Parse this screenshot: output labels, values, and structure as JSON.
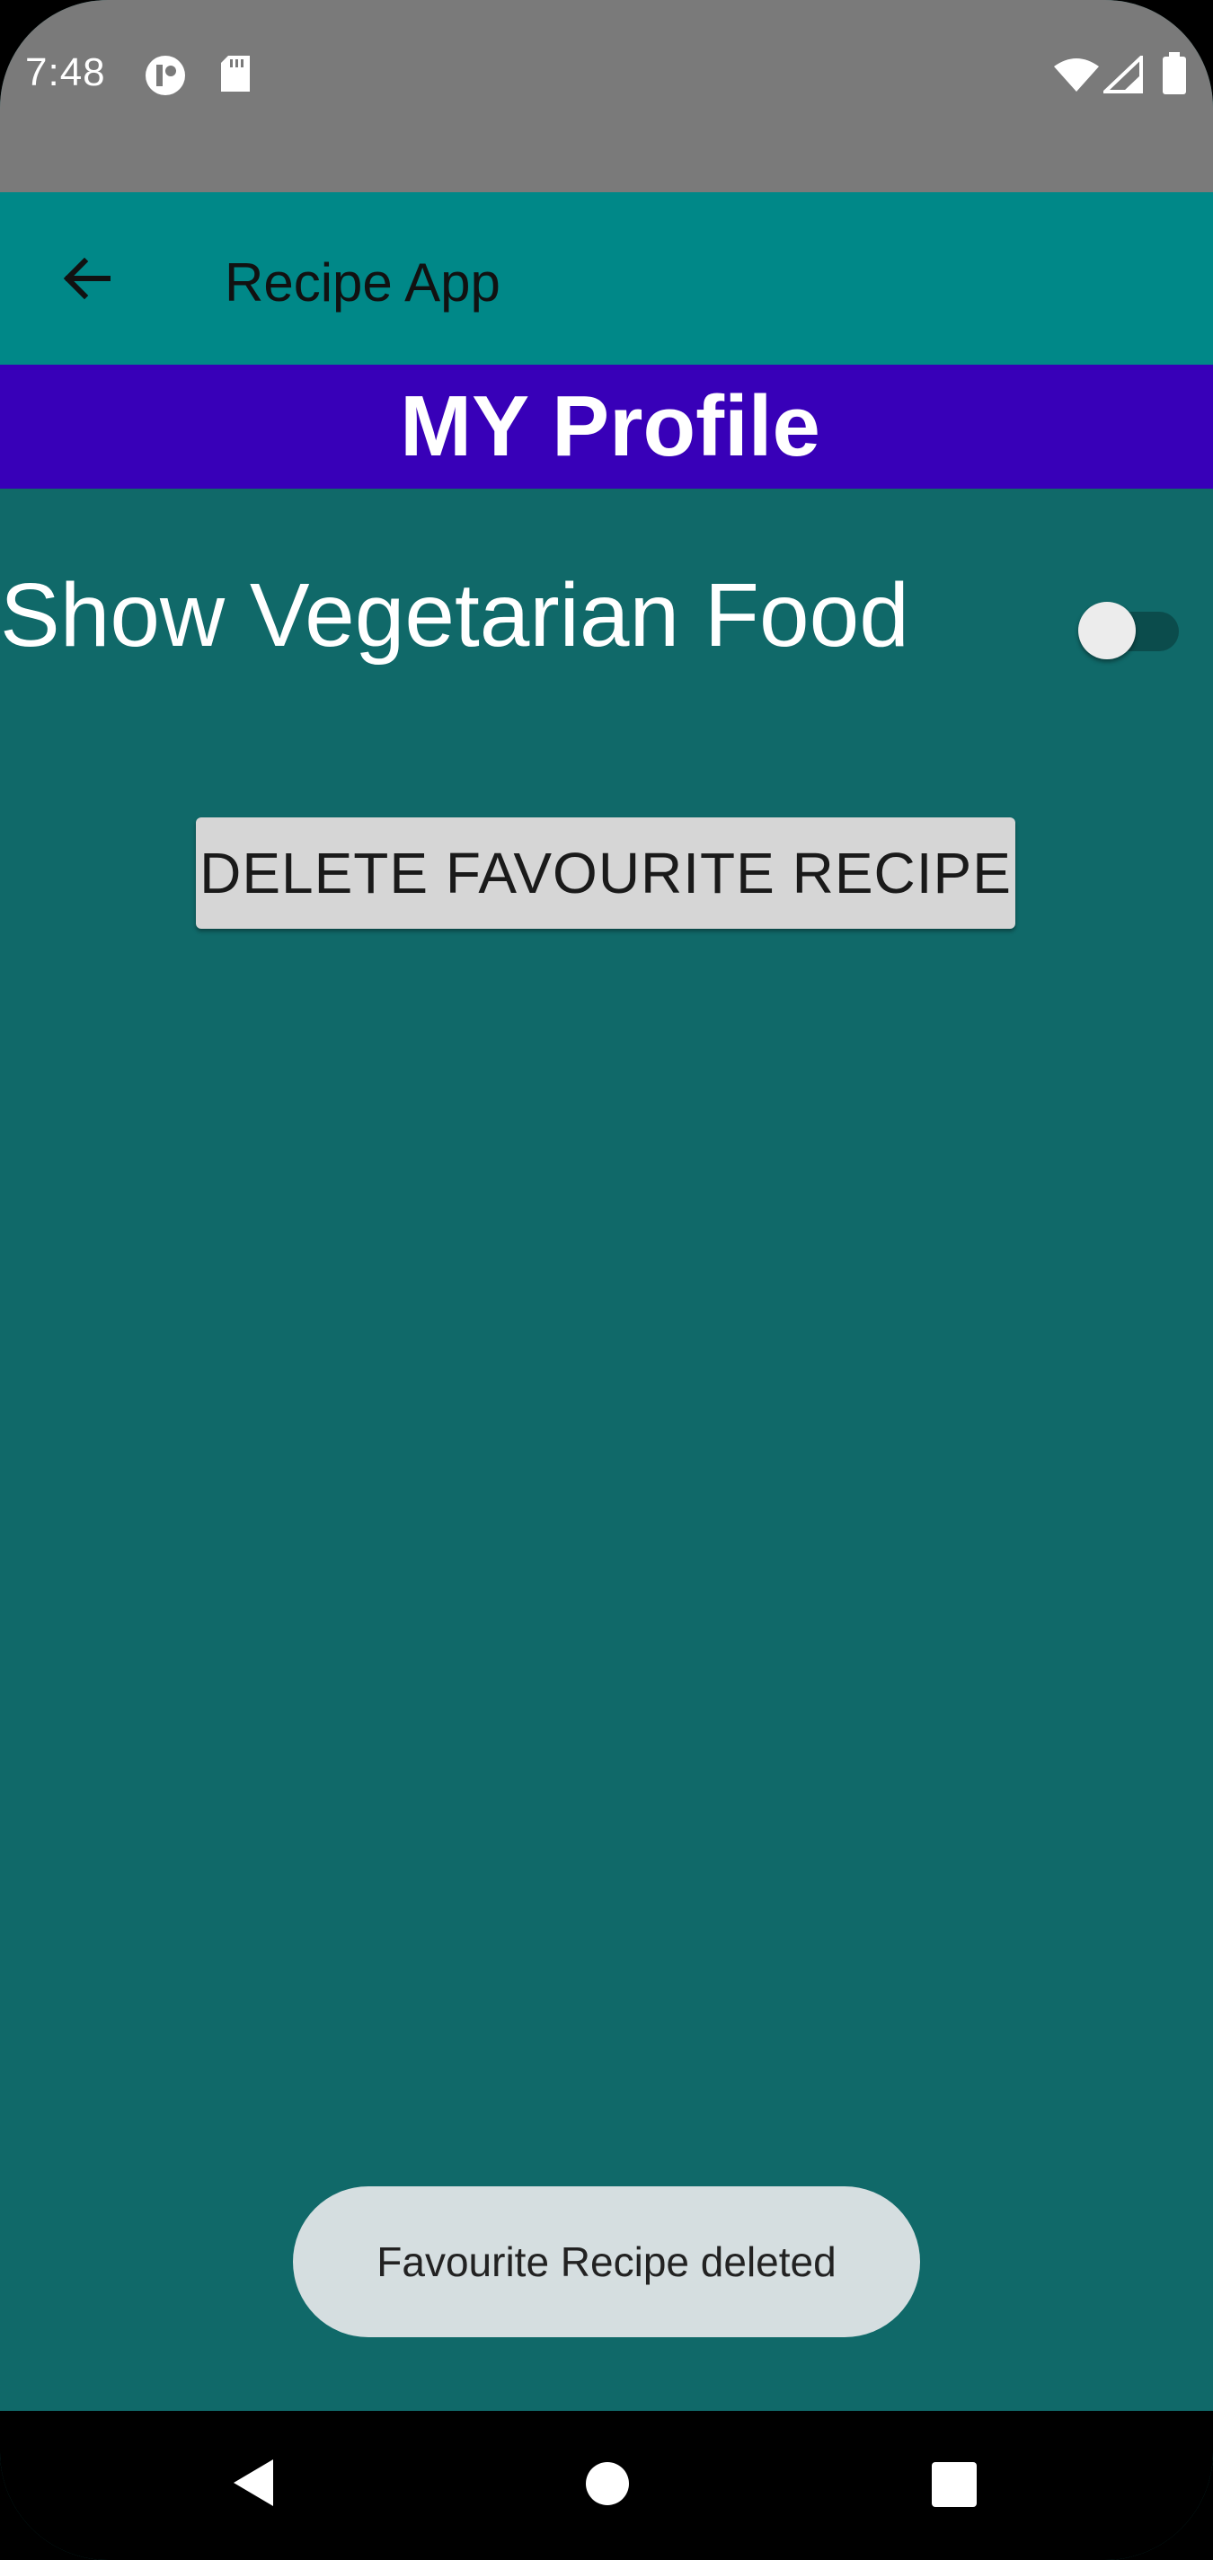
{
  "status_bar": {
    "time": "7:48",
    "left_icons": [
      "app-notification-icon",
      "sd-card-icon"
    ],
    "right_icons": [
      "wifi-icon",
      "signal-icon",
      "battery-icon"
    ]
  },
  "app_bar": {
    "title": "Recipe App",
    "back_icon": "arrow-back-icon"
  },
  "profile_banner": {
    "title": "MY Profile"
  },
  "settings": {
    "vegetarian_label": "Show Vegetarian Food",
    "vegetarian_enabled": false
  },
  "actions": {
    "delete_label": "DELETE FAVOURITE RECIPE"
  },
  "toast": {
    "message": "Favourite Recipe deleted"
  },
  "nav_bar": {
    "buttons": [
      "back-triangle-icon",
      "home-circle-icon",
      "recents-square-icon"
    ]
  },
  "colors": {
    "status_bar": "#7a7a7a",
    "app_bar": "#008888",
    "banner": "#3800b8",
    "background": "#106969",
    "toast": "#d5dee0",
    "button": "#d6d6d6"
  }
}
